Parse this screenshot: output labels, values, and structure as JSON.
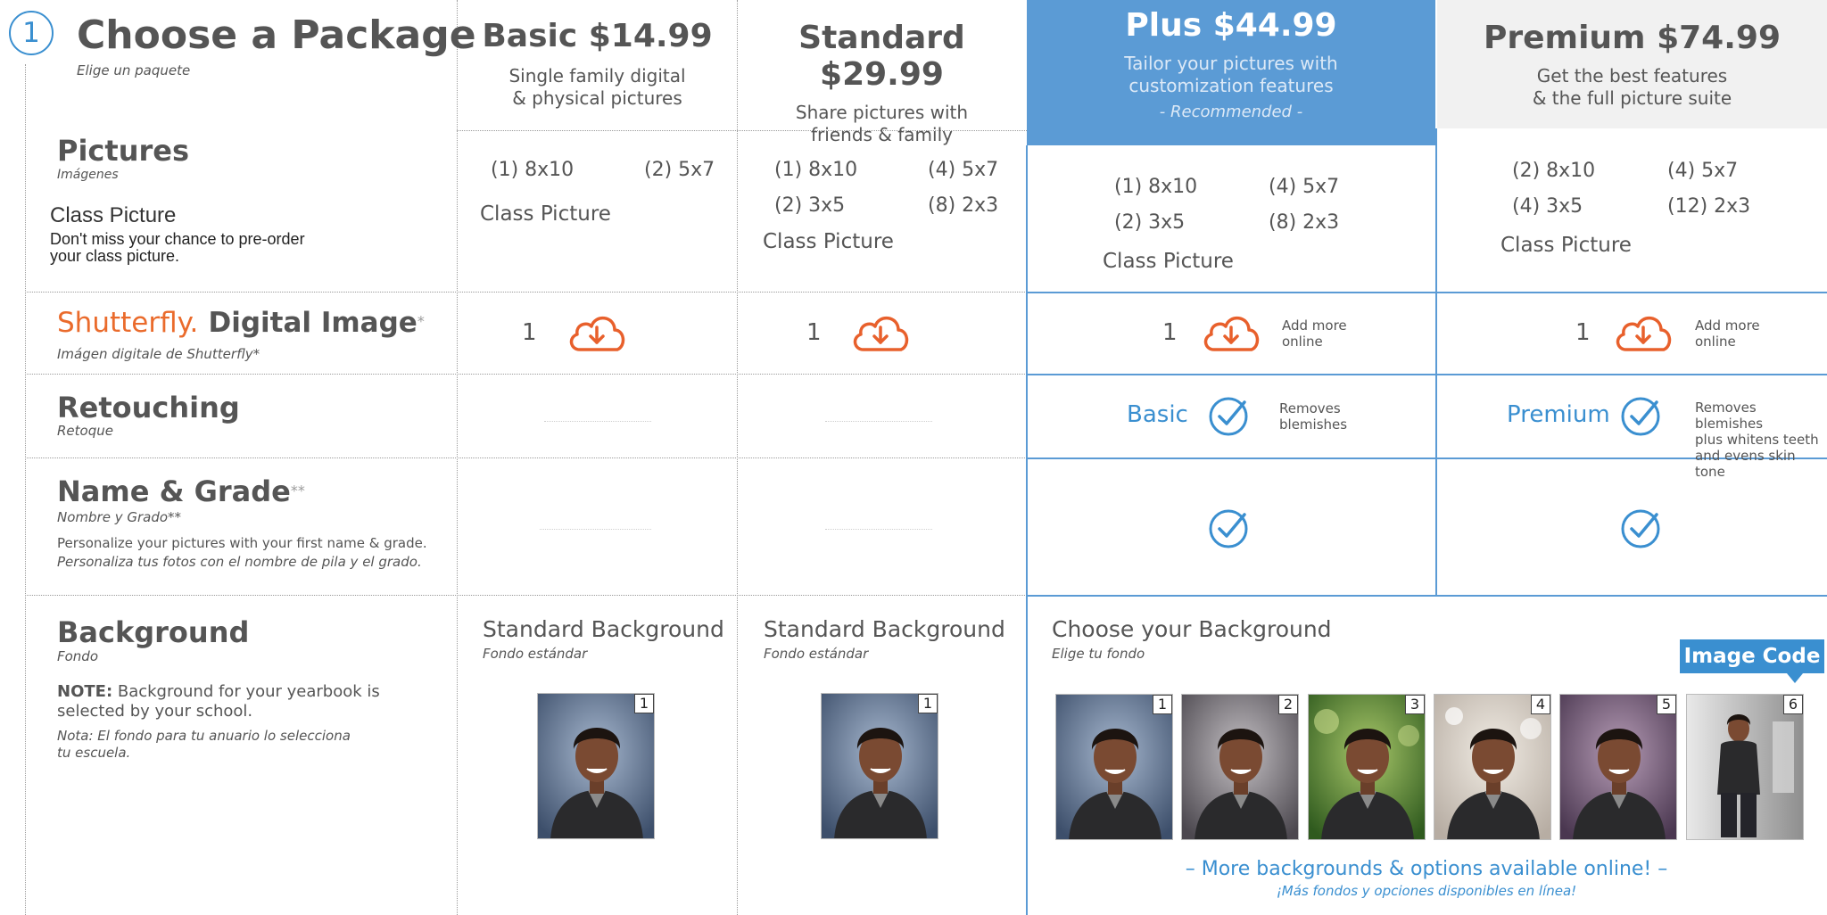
{
  "header": {
    "step_number": "1",
    "title": "Choose a Package",
    "subtitle": "Elige un paquete"
  },
  "packages": [
    {
      "title": "Basic $14.99",
      "desc_line1": "Single family digital",
      "desc_line2": "& physical pictures"
    },
    {
      "title": "Standard $29.99",
      "desc_line1": "Share pictures with",
      "desc_line2": "friends & family"
    },
    {
      "title": "Plus $44.99",
      "desc_line1": "Tailor your pictures with",
      "desc_line2": "customization features",
      "recommended": "- Recommended -"
    },
    {
      "title": "Premium $74.99",
      "desc_line1": "Get the best features",
      "desc_line2": "& the full picture suite"
    }
  ],
  "sections": {
    "pictures": {
      "title": "Pictures",
      "subtitle": "Imágenes",
      "class_title": "Class Picture",
      "class_desc_line1": "Don't miss your chance to pre-order",
      "class_desc_line2": "your class picture."
    },
    "digital": {
      "brand": "Shutterfly.",
      "title": "Digital Image",
      "mark": "*",
      "subtitle": "Imágen digitale de Shutterfly*"
    },
    "retouching": {
      "title": "Retouching",
      "subtitle": "Retoque"
    },
    "name_grade": {
      "title": "Name & Grade",
      "mark": "**",
      "subtitle": "Nombre y Grado**",
      "desc": "Personalize your pictures with your first name & grade.",
      "desc_es": "Personaliza tus fotos con el nombre de pila y el grado."
    },
    "background": {
      "title": "Background",
      "subtitle": "Fondo",
      "note_label": "NOTE:",
      "note_line1": " Background for your yearbook is",
      "note_line2": "selected by your school.",
      "note_es_line1": "Nota: El fondo para tu anuario lo selecciona",
      "note_es_line2": "tu escuela."
    }
  },
  "pictures_items": {
    "basic": [
      "(1) 8x10",
      "(2) 5x7"
    ],
    "standard": [
      "(1) 8x10",
      "(4) 5x7",
      "(2) 3x5",
      "(8) 2x3"
    ],
    "plus": [
      "(1) 8x10",
      "(4) 5x7",
      "(2) 3x5",
      "(8) 2x3"
    ],
    "premium": [
      "(2) 8x10",
      "(4) 5x7",
      "(4) 3x5",
      "(12) 2x3"
    ],
    "class_picture": "Class Picture"
  },
  "digital_items": {
    "count": "1",
    "add_more_line1": "Add more",
    "add_more_line2": "online"
  },
  "retouching_items": {
    "plus_label": "Basic",
    "plus_desc_line1": "Removes",
    "plus_desc_line2": "blemishes",
    "premium_label": "Premium",
    "premium_desc_line1": "Removes blemishes",
    "premium_desc_line2": "plus whitens teeth",
    "premium_desc_line3": "and evens skin tone"
  },
  "background_items": {
    "standard_title": "Standard Background",
    "standard_sub": "Fondo estándar",
    "choose_title": "Choose your Background",
    "choose_sub": "Elige tu fondo",
    "image_code": "Image Code",
    "photo_numbers": [
      "1",
      "2",
      "3",
      "4",
      "5",
      "6"
    ],
    "more_link": "– More backgrounds & options available online! –",
    "more_sub": "¡Más fondos y opciones disponibles en línea!"
  },
  "colors": {
    "accent_blue": "#3a8fd0",
    "recommended_bg": "#5b9bd5",
    "shutterfly_orange": "#ea6b2c",
    "icon_orange": "#e8602c"
  }
}
